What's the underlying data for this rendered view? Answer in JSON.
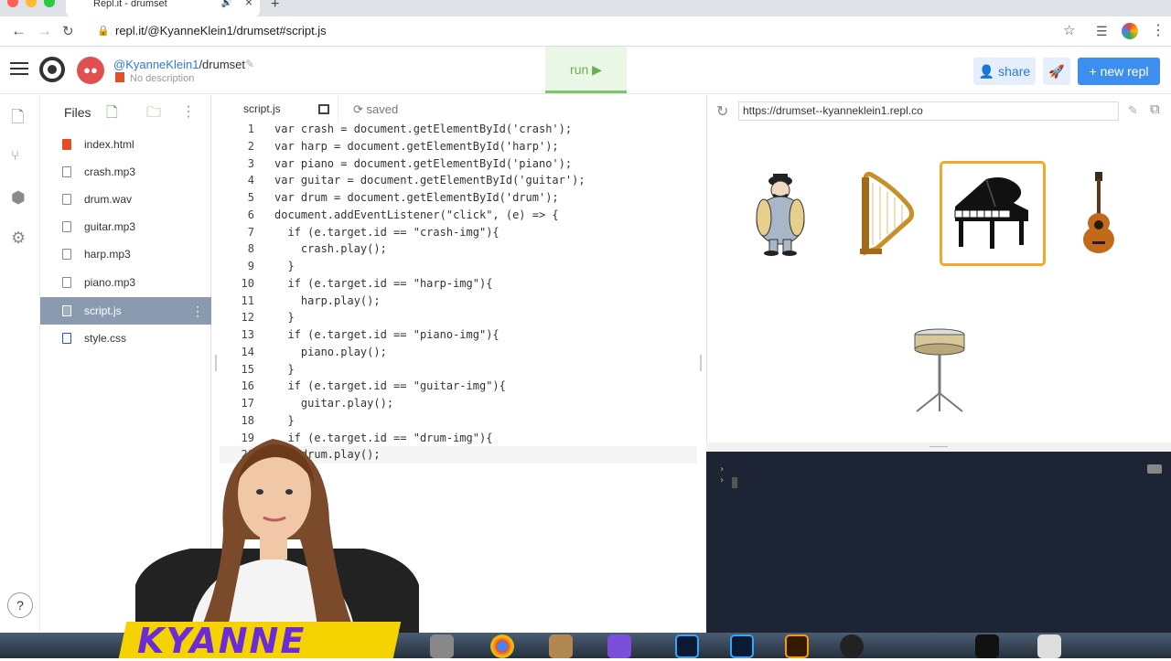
{
  "browser": {
    "tab_title": "Repl.it - drumset",
    "new_tab": "+",
    "url": "repl.it/@KyanneKlein1/drumset#script.js"
  },
  "header": {
    "username": "@KyanneKlein1",
    "repl_name": "/drumset",
    "description": "No description",
    "run_label": "run ▶",
    "share_label": "share",
    "new_repl_label": "+ new repl"
  },
  "files": {
    "title": "Files",
    "items": [
      {
        "name": "index.html",
        "type": "html"
      },
      {
        "name": "crash.mp3",
        "type": "file"
      },
      {
        "name": "drum.wav",
        "type": "file"
      },
      {
        "name": "guitar.mp3",
        "type": "file"
      },
      {
        "name": "harp.mp3",
        "type": "file"
      },
      {
        "name": "piano.mp3",
        "type": "file"
      },
      {
        "name": "script.js",
        "type": "js",
        "active": true
      },
      {
        "name": "style.css",
        "type": "css"
      }
    ]
  },
  "editor": {
    "tab_label": "script.js",
    "status": "saved",
    "lines": [
      "var crash = document.getElementById('crash');",
      "var harp = document.getElementById('harp');",
      "var piano = document.getElementById('piano');",
      "var guitar = document.getElementById('guitar');",
      "var drum = document.getElementById('drum');",
      "document.addEventListener(\"click\", (e) => {",
      "  if (e.target.id == \"crash-img\"){",
      "    crash.play();",
      "  }",
      "  if (e.target.id == \"harp-img\"){",
      "    harp.play();",
      "  }",
      "  if (e.target.id == \"piano-img\"){",
      "    piano.play();",
      "  }",
      "  if (e.target.id == \"guitar-img\"){",
      "    guitar.play();",
      "  }",
      "  if (e.target.id == \"drum-img\"){",
      "    drum.play();"
    ]
  },
  "preview": {
    "url": "https://drumset--kyanneklein1.repl.co"
  },
  "overlay": {
    "banner_text": "KYANNE"
  },
  "colors": {
    "accent": "#3d8fef",
    "run_green": "#6ab04c",
    "console_bg": "#1d2433",
    "highlight_border": "#f0a830"
  }
}
